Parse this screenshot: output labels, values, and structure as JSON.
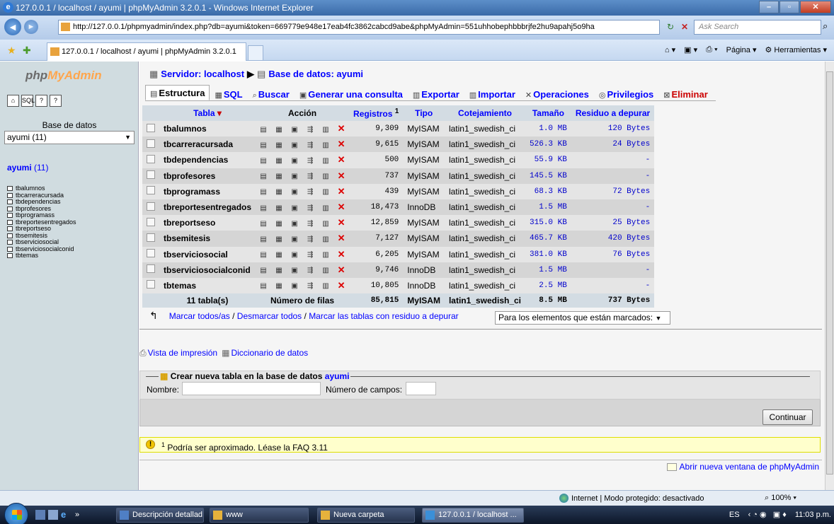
{
  "window": {
    "title": "127.0.0.1 / localhost / ayumi | phpMyAdmin 3.2.0.1 - Windows Internet Explorer",
    "url": "http://127.0.0.1/phpmyadmin/index.php?db=ayumi&token=669779e948e17eab4fc3862cabcd9abe&phpMyAdmin=551uhhobephbbbrjfe2hu9apahj5o9ha",
    "search_placeholder": "Ask Search",
    "tab_title": "127.0.0.1 / localhost / ayumi | phpMyAdmin 3.2.0.1",
    "cmd_page": "Página",
    "cmd_tools": "Herramientas"
  },
  "left": {
    "logo_a": "php",
    "logo_b": "MyAdmin",
    "db_label": "Base de datos",
    "db_selected": "ayumi (11)",
    "db_title": "ayumi",
    "db_count": " (11)",
    "tables": [
      "tbalumnos",
      "tbcarreracursada",
      "tbdependencias",
      "tbprofesores",
      "tbprogramass",
      "tbreportesentregados",
      "tbreportseso",
      "tbsemitesis",
      "tbserviciosocial",
      "tbserviciosocialconid",
      "tbtemas"
    ]
  },
  "breadcrumb": {
    "server": "Servidor: localhost",
    "database": "Base de datos: ayumi"
  },
  "tabs": [
    {
      "label": "Estructura",
      "icon": "▤"
    },
    {
      "label": "SQL",
      "icon": "▦"
    },
    {
      "label": "Buscar",
      "icon": "⌕"
    },
    {
      "label": "Generar una consulta",
      "icon": "▣"
    },
    {
      "label": "Exportar",
      "icon": "▥"
    },
    {
      "label": "Importar",
      "icon": "▥"
    },
    {
      "label": "Operaciones",
      "icon": "✕"
    },
    {
      "label": "Privilegios",
      "icon": "◎"
    },
    {
      "label": "Eliminar",
      "icon": "⊠"
    }
  ],
  "table": {
    "headers": {
      "tabla": "Tabla",
      "accion": "Acción",
      "registros": "Registros",
      "registros_sup": "1",
      "tipo": "Tipo",
      "cotejamiento": "Cotejamiento",
      "tamano": "Tamaño",
      "residuo": "Residuo a depurar"
    },
    "rows": [
      {
        "name": "tbalumnos",
        "records": "9,309",
        "type": "MyISAM",
        "collation": "latin1_swedish_ci",
        "size": "1.0 MB",
        "overhead": "120 Bytes"
      },
      {
        "name": "tbcarreracursada",
        "records": "9,615",
        "type": "MyISAM",
        "collation": "latin1_swedish_ci",
        "size": "526.3 KB",
        "overhead": "24 Bytes"
      },
      {
        "name": "tbdependencias",
        "records": "500",
        "type": "MyISAM",
        "collation": "latin1_swedish_ci",
        "size": "55.9 KB",
        "overhead": "-"
      },
      {
        "name": "tbprofesores",
        "records": "737",
        "type": "MyISAM",
        "collation": "latin1_swedish_ci",
        "size": "145.5 KB",
        "overhead": "-"
      },
      {
        "name": "tbprogramass",
        "records": "439",
        "type": "MyISAM",
        "collation": "latin1_swedish_ci",
        "size": "68.3 KB",
        "overhead": "72 Bytes"
      },
      {
        "name": "tbreportesentregados",
        "records": "18,473",
        "type": "InnoDB",
        "collation": "latin1_swedish_ci",
        "size": "1.5 MB",
        "overhead": "-"
      },
      {
        "name": "tbreportseso",
        "records": "12,859",
        "type": "MyISAM",
        "collation": "latin1_swedish_ci",
        "size": "315.0 KB",
        "overhead": "25 Bytes"
      },
      {
        "name": "tbsemitesis",
        "records": "7,127",
        "type": "MyISAM",
        "collation": "latin1_swedish_ci",
        "size": "465.7 KB",
        "overhead": "420 Bytes"
      },
      {
        "name": "tbserviciosocial",
        "records": "6,205",
        "type": "MyISAM",
        "collation": "latin1_swedish_ci",
        "size": "381.0 KB",
        "overhead": "76 Bytes"
      },
      {
        "name": "tbserviciosocialconid",
        "records": "9,746",
        "type": "InnoDB",
        "collation": "latin1_swedish_ci",
        "size": "1.5 MB",
        "overhead": "-"
      },
      {
        "name": "tbtemas",
        "records": "10,805",
        "type": "InnoDB",
        "collation": "latin1_swedish_ci",
        "size": "2.5 MB",
        "overhead": "-"
      }
    ],
    "footer": {
      "count": "11 tabla(s)",
      "rows_label": "Número de filas",
      "records": "85,815",
      "type": "MyISAM",
      "collation": "latin1_swedish_ci",
      "size": "8.5 MB",
      "overhead": "737 Bytes"
    }
  },
  "select_links": {
    "check_all": "Marcar todos/as",
    "uncheck_all": "Desmarcar todos",
    "check_overhead": "Marcar las tablas con residuo a depurar",
    "with_selected": "Para los elementos que están marcados:"
  },
  "print_links": {
    "print_view": "Vista de impresión",
    "dictionary": "Diccionario de datos"
  },
  "create": {
    "legend": "Crear nueva tabla en la base de datos",
    "db": "ayumi",
    "name_label": "Nombre:",
    "fields_label": "Número de campos:",
    "submit": "Continuar"
  },
  "notice": {
    "sup": "1",
    "text": "Podría ser aproximado. Léase la FAQ 3.11"
  },
  "newwin": "Abrir nueva ventana de phpMyAdmin",
  "status": {
    "zone": "Internet | Modo protegido: desactivado",
    "zoom": "100%"
  },
  "taskbar": {
    "tasks": [
      "Descripción detallad...",
      "www",
      "Nueva carpeta",
      "127.0.0.1 / localhost ..."
    ],
    "lang": "ES",
    "time": "11:03 p.m."
  }
}
